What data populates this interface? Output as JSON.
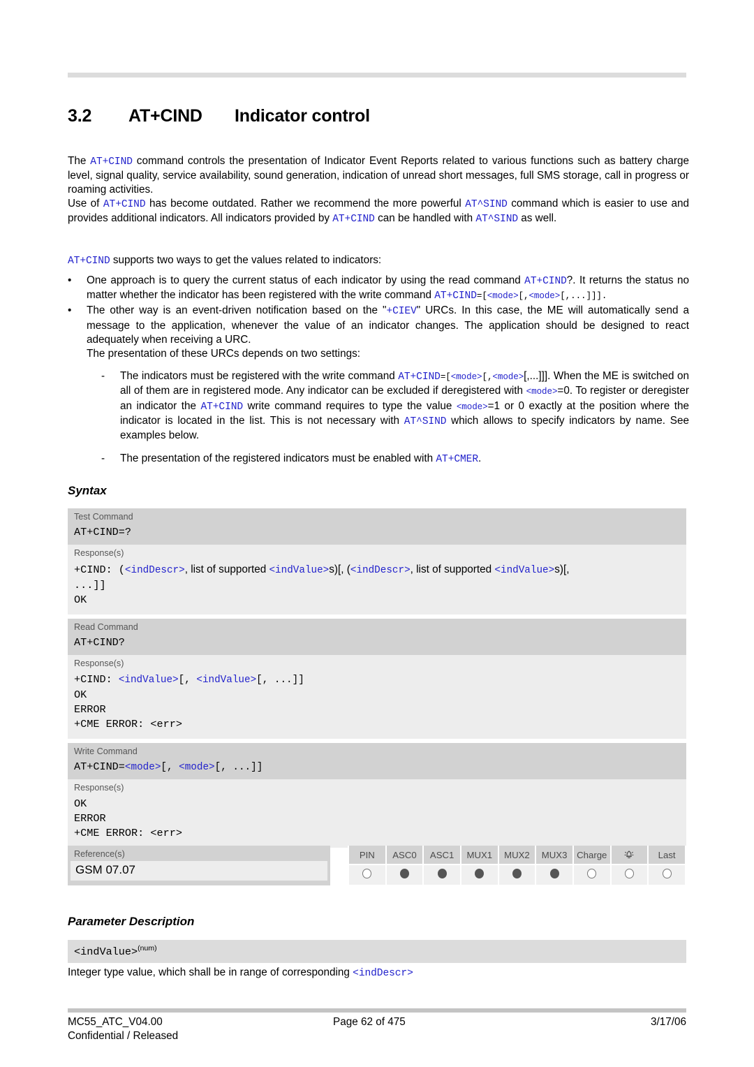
{
  "heading": {
    "number": "3.2",
    "command": "AT+CIND",
    "title": "Indicator control"
  },
  "intro": {
    "p1_a": "The ",
    "p1_cmd": "AT+CIND",
    "p1_b": " command controls the presentation of Indicator Event Reports related to various functions such as battery charge level, signal quality, service availability, sound generation, indication of unread short messages, full SMS storage, call in progress or roaming activities.",
    "p2_a": "Use of ",
    "p2_cmd1": "AT+CIND",
    "p2_b": " has become outdated. Rather we recommend the more powerful ",
    "p2_cmd2": "AT^SIND",
    "p2_c": " command which is easier to use and provides additional indicators. All indicators provided by ",
    "p2_cmd3": "AT+CIND",
    "p2_d": " can be handled with ",
    "p2_cmd4": "AT^SIND",
    "p2_e": " as well.",
    "p3_cmd": "AT+CIND",
    "p3_text": " supports two ways to get the values related to indicators:"
  },
  "bullets": {
    "mark": "•",
    "sub_mark": "-",
    "b1_a": "One approach is to query the current status of each indicator by using the read command ",
    "b1_cmd": "AT+CIND",
    "b1_b": "?. It returns the status no matter whether the indicator has been registered with the write command ",
    "b1_cmd2": "AT+CIND",
    "b1_eq": "=[",
    "b1_mode1": "<mode>",
    "b1_c": "[,",
    "b1_mode2": "<mode>",
    "b1_d": "[,...]]].",
    "b2_a": "The other way is an event-driven notification based on the \"",
    "b2_cmd": "+CIEV",
    "b2_b": "\" URCs. In this case, the ME will automatically send a message to the application, whenever the value of an indicator changes. The application should be designed to react adequately when receiving a URC.",
    "b2_c": "The presentation of these URCs depends on two settings:",
    "s1_a": "The indicators must be registered with the write command ",
    "s1_cmd": "AT+CIND",
    "s1_eq": "=[",
    "s1_mode1": "<mode>",
    "s1_b": "[,",
    "s1_mode2": "<mode>",
    "s1_c": "[,...]]]. When the ME is switched on all of them are in registered mode. Any indicator can be excluded if deregistered with ",
    "s1_mode3": "<mode>",
    "s1_d": "=0. To register or deregister an indicator the ",
    "s1_cmd2": "AT+CIND",
    "s1_e": " write command requires to type the value ",
    "s1_mode4": "<mode>",
    "s1_f": "=1 or 0 exactly at the position where the indicator is located in the list. This is not necessary with ",
    "s1_cmd3": "AT^SIND",
    "s1_g": " which allows to specify indicators by name. See examples below.",
    "s2_a": "The presentation of the registered indicators must be enabled with ",
    "s2_cmd": "AT+CMER",
    "s2_b": "."
  },
  "sections": {
    "syntax": "Syntax",
    "parameter_description": "Parameter Description"
  },
  "syntax": {
    "test": {
      "header": "Test Command",
      "command": "AT+CIND=?",
      "response_header": "Response(s)",
      "r_prefix": "+CIND: (",
      "r_indDescr1": "<indDescr>",
      "r_t1": ", list of supported ",
      "r_indValue1": "<indValue>",
      "r_t2": "s)[, (",
      "r_indDescr2": "<indDescr>",
      "r_t3": ", list of supported ",
      "r_indValue2": "<indValue>",
      "r_t4": "s)[,",
      "r_line2": "...]]",
      "r_ok": "OK"
    },
    "read": {
      "header": "Read Command",
      "command": "AT+CIND?",
      "response_header": "Response(s)",
      "r_prefix": "+CIND: ",
      "r_indValue1": "<indValue>",
      "r_t1": "[, ",
      "r_indValue2": "<indValue>",
      "r_t2": "[, ...]]",
      "r_ok": "OK",
      "r_error": "ERROR",
      "r_cme_a": "+CME ERROR: ",
      "r_cme_err": "<err>"
    },
    "write": {
      "header": "Write Command",
      "c_prefix": "AT+CIND=",
      "c_mode1": "<mode>",
      "c_t1": "[, ",
      "c_mode2": "<mode>",
      "c_t2": "[, ...]]",
      "response_header": "Response(s)",
      "r_ok": "OK",
      "r_error": "ERROR",
      "r_cme_a": "+CME ERROR: ",
      "r_cme_err": "<err>"
    }
  },
  "reference": {
    "header": "Reference(s)",
    "value": "GSM 07.07"
  },
  "indicators": {
    "columns": [
      "PIN",
      "ASC0",
      "ASC1",
      "MUX1",
      "MUX2",
      "MUX3",
      "Charge",
      "alarm-icon",
      "Last"
    ],
    "states": [
      "off",
      "on",
      "on",
      "on",
      "on",
      "on",
      "off",
      "off",
      "off"
    ]
  },
  "parameter": {
    "name": "<indValue>",
    "superscript": "(num)",
    "desc_a": "Integer type value, which shall be in range of corresponding ",
    "desc_ref": "<indDescr>"
  },
  "footer": {
    "document": "MC55_ATC_V04.00",
    "page": "Page 62 of 475",
    "date": "3/17/06",
    "classification": "Confidential / Released"
  },
  "colors": {
    "command_blue": "#2222cc",
    "band_gray": "#d2d2d2",
    "response_gray": "#ededed"
  }
}
